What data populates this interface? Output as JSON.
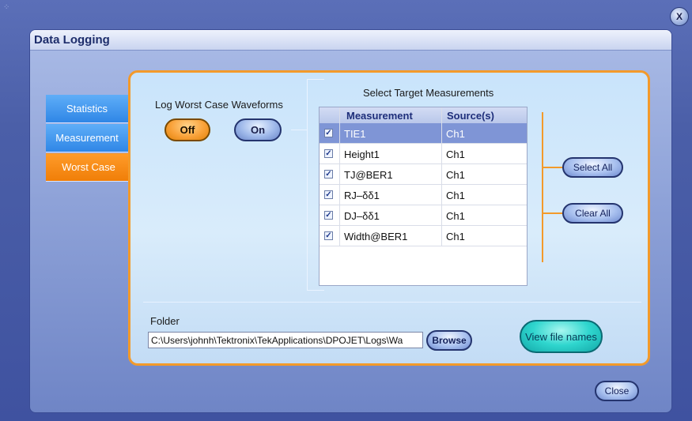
{
  "title": "Data Logging",
  "tabs": [
    {
      "label": "Statistics"
    },
    {
      "label": "Measurement"
    },
    {
      "label": "Worst Case"
    }
  ],
  "log_section": {
    "label": "Log Worst Case Waveforms",
    "off_label": "Off",
    "on_label": "On",
    "selected": "Off"
  },
  "targets": {
    "label": "Select Target Measurements",
    "columns": [
      "Measurement",
      "Source(s)"
    ],
    "rows": [
      {
        "measurement": "TIE1",
        "source": "Ch1",
        "checked": true,
        "selected": true
      },
      {
        "measurement": "Height1",
        "source": "Ch1",
        "checked": true,
        "selected": false
      },
      {
        "measurement": "TJ@BER1",
        "source": "Ch1",
        "checked": true,
        "selected": false
      },
      {
        "measurement": "RJ–δδ1",
        "source": "Ch1",
        "checked": true,
        "selected": false
      },
      {
        "measurement": "DJ–δδ1",
        "source": "Ch1",
        "checked": true,
        "selected": false
      },
      {
        "measurement": "Width@BER1",
        "source": "Ch1",
        "checked": true,
        "selected": false
      }
    ],
    "select_all_label": "Select All",
    "clear_all_label": "Clear All"
  },
  "folder": {
    "label": "Folder",
    "value": "C:\\Users\\johnh\\Tektronix\\TekApplications\\DPOJET\\Logs\\Wa",
    "browse_label": "Browse"
  },
  "view_file_names_label": "View file names",
  "close_label": "Close",
  "window_close_label": "X",
  "colors": {
    "accent": "#f39a2a",
    "tab_blue": "#2f86e6",
    "tab_active": "#f07e08"
  }
}
